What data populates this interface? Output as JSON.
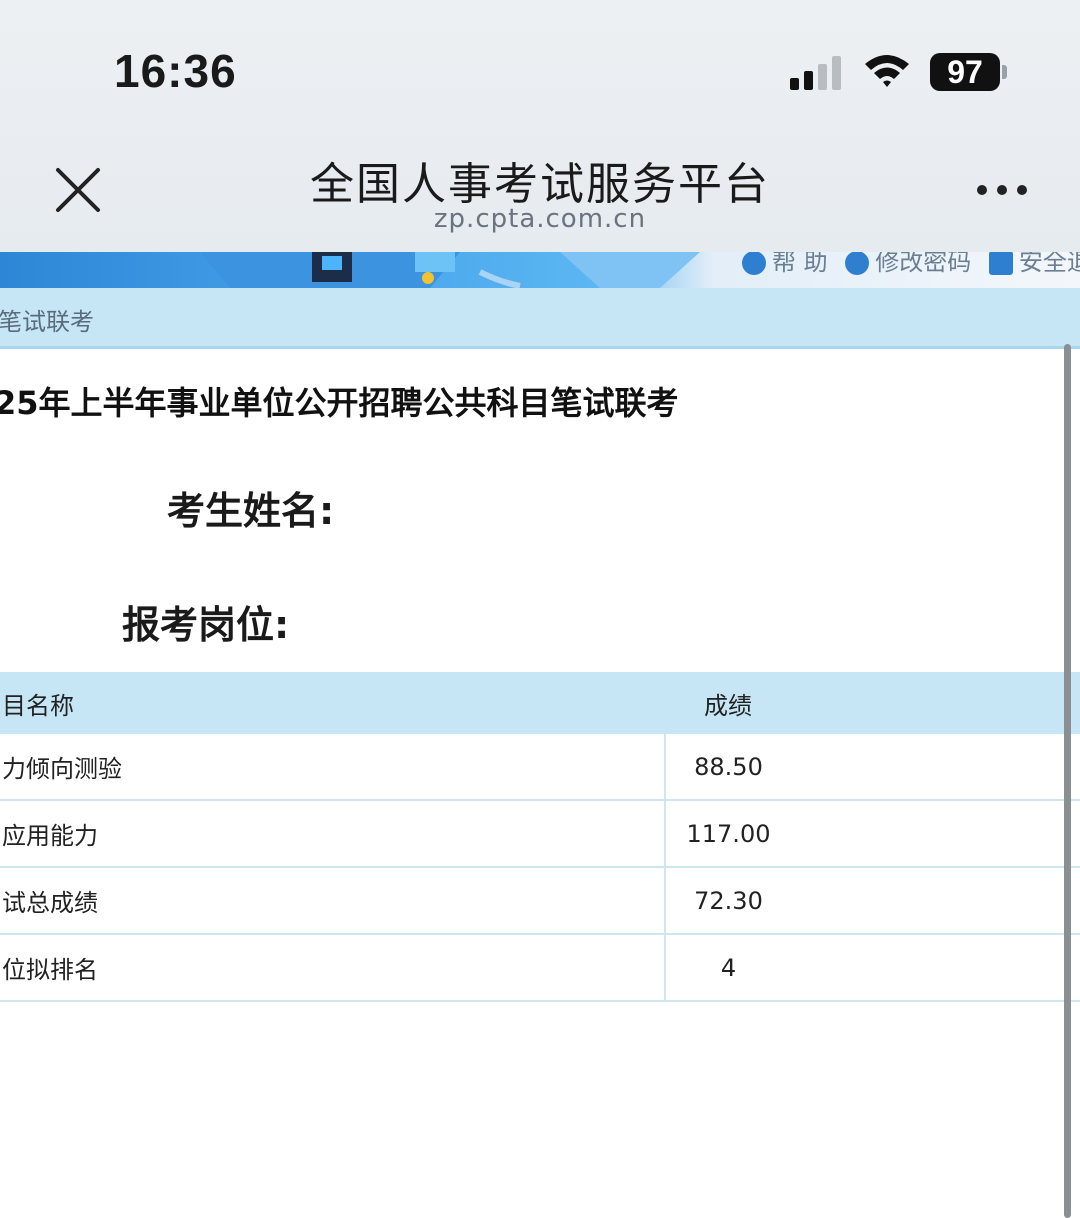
{
  "status_bar": {
    "time": "16:36",
    "battery": "97",
    "icons": [
      "signal-icon",
      "wifi-icon",
      "battery-icon"
    ]
  },
  "nav": {
    "title": "全国人事考试服务平台",
    "subtitle": "zp.cpta.com.cn",
    "icons": [
      "close-icon",
      "more-icon"
    ]
  },
  "banner": {
    "links": [
      "帮 助",
      "修改密码",
      "安全退"
    ]
  },
  "breadcrumb": "笔试联考",
  "exam": {
    "title": "25年上半年事业单位公开招聘公共科目笔试联考",
    "name_label": "考生姓名:",
    "position_label": "报考岗位:"
  },
  "table": {
    "headers": [
      "目名称",
      "成绩"
    ],
    "rows": [
      {
        "subject": "力倾向测验",
        "score": "88.50"
      },
      {
        "subject": "应用能力",
        "score": "117.00"
      },
      {
        "subject": "试总成绩",
        "score": "72.30"
      },
      {
        "subject": "位拟排名",
        "score": "4"
      }
    ]
  },
  "colors": {
    "header_bg": "#c6e6f6",
    "border": "#cfe5f2",
    "banner_blue": "#2e86d6"
  }
}
